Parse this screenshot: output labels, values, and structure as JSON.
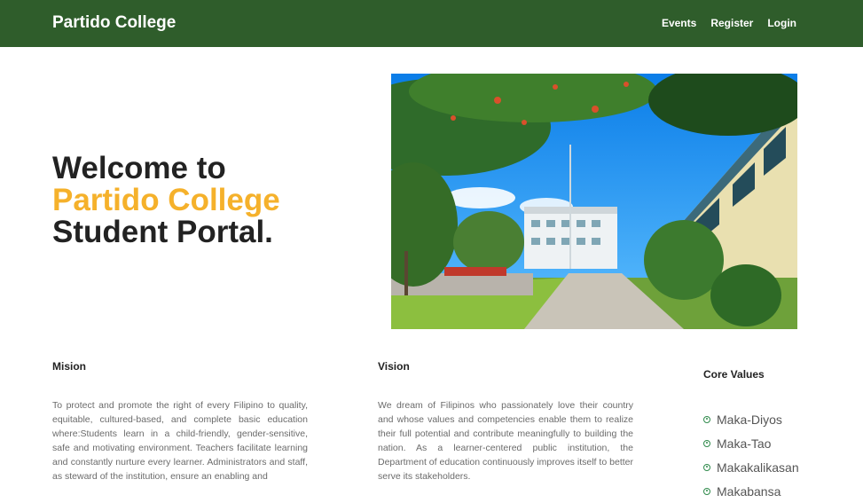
{
  "nav": {
    "brand": "Partido College",
    "links": [
      "Events",
      "Register",
      "Login"
    ]
  },
  "hero": {
    "line1": "Welcome to",
    "line2": "Partido College",
    "line3": "Student Portal."
  },
  "colors": {
    "navbar": "#2f5d2b",
    "accent": "#f5b12b",
    "bullet": "#2f8a4b"
  },
  "mission": {
    "title": "Mision",
    "text": "To protect and promote the right of every Filipino to quality, equitable, cultured-based, and complete basic education where:Students learn in a child-friendly, gender-sensitive, safe and motivating environment. Teachers facilitate learning and constantly nurture every learner. Administrators and staff, as steward of the institution, ensure an enabling and"
  },
  "vision": {
    "title": "Vision",
    "text": "We dream of Filipinos who passionately love their country and whose values and competencies enable them to realize their full potential and contribute meaningfully to building the nation. As a learner-centered public institution, the Department of education continuously improves itself to better serve its stakeholders."
  },
  "core_values": {
    "title": "Core Values",
    "items": [
      "Maka-Diyos",
      "Maka-Tao",
      "Makakalikasan",
      "Makabansa"
    ]
  }
}
